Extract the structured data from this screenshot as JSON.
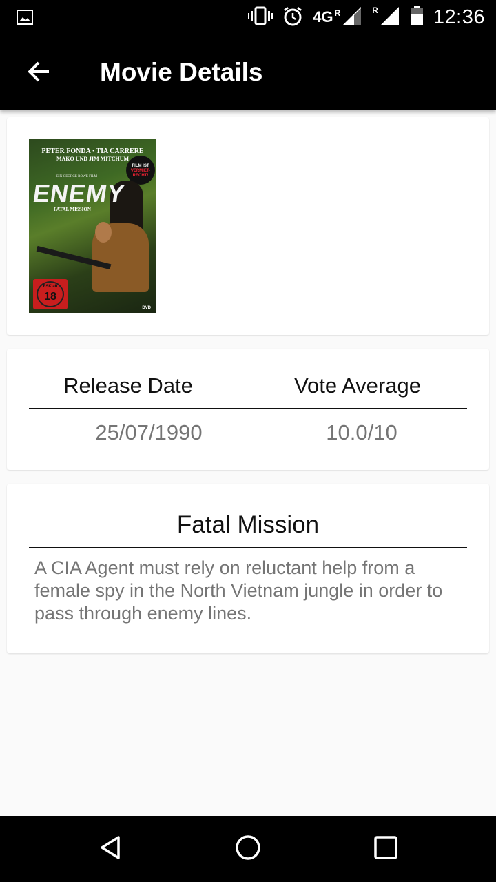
{
  "status_bar": {
    "time": "12:36",
    "network": "4G",
    "roaming_label": "R",
    "icons": [
      "gallery-icon",
      "vibrate-icon",
      "alarm-icon",
      "signal-icon",
      "signal-icon",
      "battery-icon"
    ]
  },
  "app_bar": {
    "title": "Movie Details",
    "back_icon": "arrow-back-icon"
  },
  "poster": {
    "cast_line_1": "PETER FONDA · TIA CARRERE",
    "cast_line_2": "MAKO UND JIM MITCHUM",
    "tagline": "EIN GEORGE ROWE FILM",
    "title": "ENEMY",
    "subtitle": "FATAL MISSION",
    "badge_line_1": "FILM IST",
    "badge_line_2": "VERMIET-",
    "badge_line_3": "RECHT!",
    "fsk_label": "FSK ab",
    "fsk_age": "18",
    "format": "DVD"
  },
  "stats": {
    "release_date_label": "Release Date",
    "vote_average_label": "Vote Average",
    "release_date": "25/07/1990",
    "vote_average": "10.0/10"
  },
  "overview": {
    "title": "Fatal Mission",
    "text": "A CIA Agent must rely on reluctant help from a female spy in the North Vietnam jungle in order to pass through enemy lines."
  },
  "colors": {
    "app_bar": "#000000",
    "background": "#fafafa",
    "secondary_text": "#757575"
  }
}
